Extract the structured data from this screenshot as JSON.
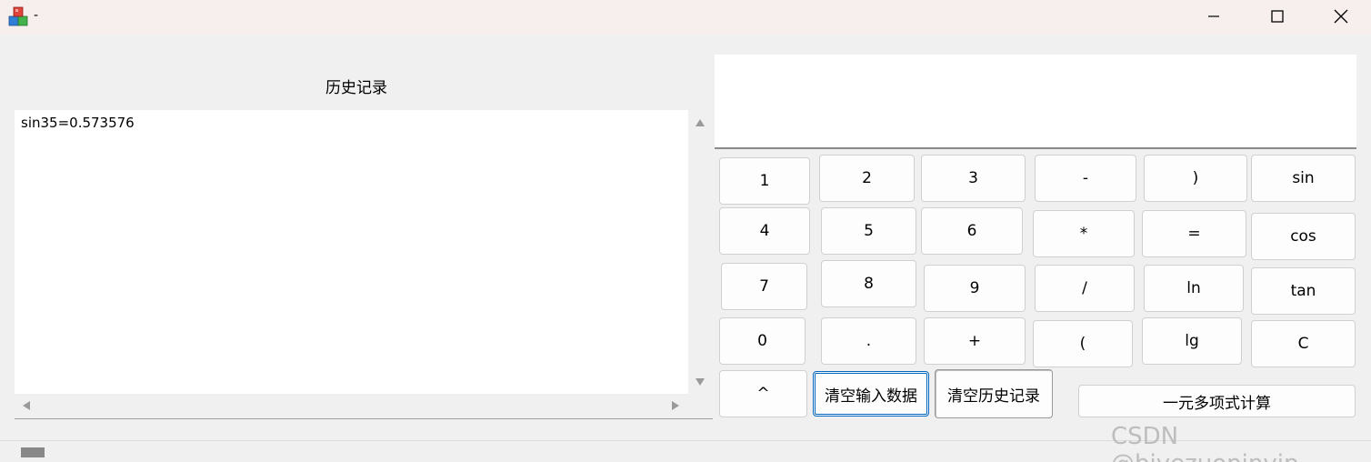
{
  "window": {
    "title": "-",
    "app_icon": "cubes-app-icon",
    "controls": {
      "minimize": "minimize-icon",
      "maximize": "maximize-icon",
      "close": "close-icon"
    }
  },
  "history": {
    "label": "历史记录",
    "text": "sin35=0.573576"
  },
  "display": {
    "value": ""
  },
  "keypad": {
    "k1": "1",
    "k2": "2",
    "k3": "3",
    "kminus": "-",
    "krparen": ")",
    "ksin": "sin",
    "k4": "4",
    "k5": "5",
    "k6": "6",
    "kmul": "*",
    "keq": "=",
    "kcos": "cos",
    "k7": "7",
    "k8": "8",
    "k9": "9",
    "kdiv": "/",
    "kln": "ln",
    "ktan": "tan",
    "k0": "0",
    "kdot": ".",
    "kplus": "+",
    "klparen": "(",
    "klg": "lg",
    "kclear": "C",
    "kpow": "^",
    "clear_input": "清空输入数据",
    "clear_history": "清空历史记录",
    "polynomial": "一元多项式计算"
  },
  "watermark": "CSDN @biyezuopinvip"
}
